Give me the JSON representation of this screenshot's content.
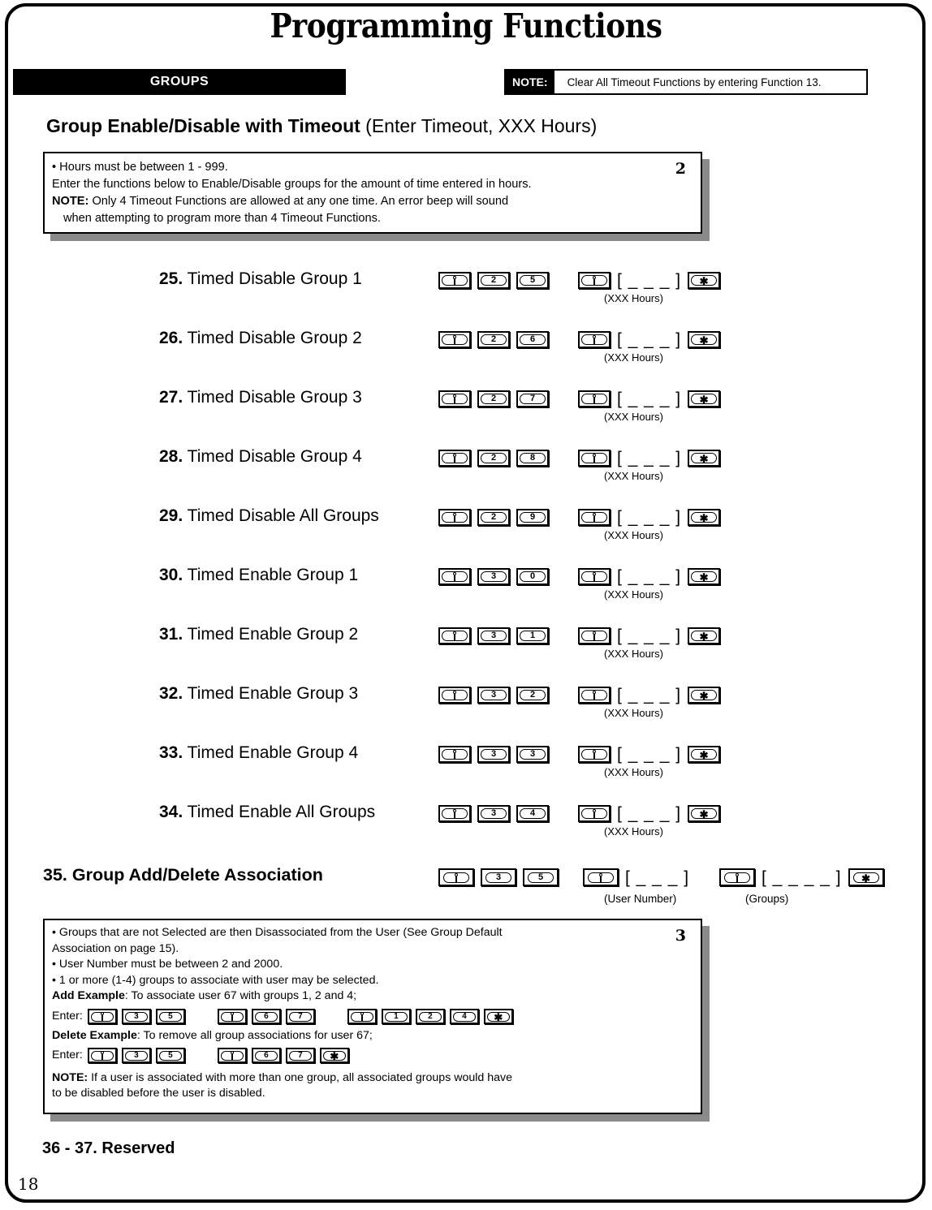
{
  "page": {
    "title": "Programming Functions",
    "page_number": "18",
    "reserved_line": "36 - 37. Reserved"
  },
  "banner": {
    "groups_label": "GROUPS"
  },
  "top_note": {
    "label": "NOTE:",
    "text": "Clear All Timeout Functions by entering Function 13."
  },
  "section_heading": {
    "bold_part": "Group Enable/Disable with Timeout",
    "regular_part": " (Enter Timeout, XXX Hours)"
  },
  "info_box_2": {
    "corner_number": "2",
    "line1": "• Hours must be between 1 - 999.",
    "line2": "Enter the functions below to Enable/Disable groups for the amount of time entered in hours.",
    "line3_bold": "NOTE:",
    "line3": "  Only 4 Timeout Functions are allowed at any one time.  An error beep will sound",
    "line4": "when attempting to program more than 4 Timeout Functions."
  },
  "functions": [
    {
      "num": "25.",
      "label": " Timed Disable Group 1",
      "keys": [
        "fn",
        "2",
        "5"
      ],
      "value_keys": [
        "fn"
      ],
      "field": "[ _ _ _ ]",
      "end_key": "*",
      "sub_note": "(XXX Hours)"
    },
    {
      "num": "26.",
      "label": " Timed Disable Group 2",
      "keys": [
        "fn",
        "2",
        "6"
      ],
      "value_keys": [
        "fn"
      ],
      "field": "[ _ _ _ ]",
      "end_key": "*",
      "sub_note": "(XXX Hours)"
    },
    {
      "num": "27.",
      "label": " Timed Disable Group 3",
      "keys": [
        "fn",
        "2",
        "7"
      ],
      "value_keys": [
        "fn"
      ],
      "field": "[ _ _ _ ]",
      "end_key": "*",
      "sub_note": "(XXX Hours)"
    },
    {
      "num": "28.",
      "label": " Timed Disable Group 4",
      "keys": [
        "fn",
        "2",
        "8"
      ],
      "value_keys": [
        "fn"
      ],
      "field": "[ _ _ _ ]",
      "end_key": "*",
      "sub_note": "(XXX Hours)"
    },
    {
      "num": "29.",
      "label": " Timed Disable All Groups",
      "keys": [
        "fn",
        "2",
        "9"
      ],
      "value_keys": [
        "fn"
      ],
      "field": "[ _ _ _ ]",
      "end_key": "*",
      "sub_note": "(XXX Hours)"
    },
    {
      "num": "30.",
      "label": " Timed Enable Group 1",
      "keys": [
        "fn",
        "3",
        "0"
      ],
      "value_keys": [
        "fn"
      ],
      "field": "[ _ _ _ ]",
      "end_key": "*",
      "sub_note": "(XXX Hours)"
    },
    {
      "num": "31.",
      "label": " Timed Enable Group 2",
      "keys": [
        "fn",
        "3",
        "1"
      ],
      "value_keys": [
        "fn"
      ],
      "field": "[ _ _ _ ]",
      "end_key": "*",
      "sub_note": "(XXX Hours)"
    },
    {
      "num": "32.",
      "label": " Timed Enable Group 3",
      "keys": [
        "fn",
        "3",
        "2"
      ],
      "value_keys": [
        "fn"
      ],
      "field": "[ _ _ _ ]",
      "end_key": "*",
      "sub_note": "(XXX Hours)"
    },
    {
      "num": "33.",
      "label": " Timed Enable Group 4",
      "keys": [
        "fn",
        "3",
        "3"
      ],
      "value_keys": [
        "fn"
      ],
      "field": "[ _ _ _ ]",
      "end_key": "*",
      "sub_note": "(XXX Hours)"
    },
    {
      "num": "34.",
      "label": " Timed Enable All Groups",
      "keys": [
        "fn",
        "3",
        "4"
      ],
      "value_keys": [
        "fn"
      ],
      "field": "[ _ _ _ ]",
      "end_key": "*",
      "sub_note": "(XXX Hours)"
    }
  ],
  "section_35": {
    "heading": "35. Group Add/Delete Association",
    "keys": [
      "fn",
      "3",
      "5"
    ],
    "user_field": "[ _ _ _ ]",
    "user_sub_note": "(User Number)",
    "groups_field": "[ _ _ _ _ ]",
    "groups_sub_note": "(Groups)",
    "end_key": "*"
  },
  "info_box_3": {
    "corner_number": "3",
    "bullet1": "• Groups that are not Selected are then Disassociated from the User (See Group Default",
    "bullet1b": "Association on page 15).",
    "bullet2": "• User Number must be between 2 and 2000.",
    "bullet3": "• 1 or more (1-4) groups to associate with user may be selected.",
    "add_example_bold": "Add Example",
    "add_example_text": ": To associate user 67 with groups 1, 2 and 4;",
    "enter_label_1": "Enter:",
    "add_keys_g1": [
      "fn",
      "3",
      "5"
    ],
    "add_keys_g2": [
      "fn",
      "6",
      "7"
    ],
    "add_keys_g3": [
      "fn",
      "1",
      "2",
      "4",
      "*"
    ],
    "delete_example_bold": "Delete Example",
    "delete_example_text": ": To remove all group associations for user 67;",
    "enter_label_2": "Enter:",
    "del_keys_g1": [
      "fn",
      "3",
      "5"
    ],
    "del_keys_g2": [
      "fn",
      "6",
      "7",
      "*"
    ],
    "note_bold": "NOTE:",
    "note_line1": "  If a user is associated with more than one group, all associated groups would have",
    "note_line2": "to be disabled before the user is disabled."
  },
  "colors": {
    "ink": "#000000",
    "paper": "#ffffff",
    "shadow": "#8a8a8a"
  }
}
